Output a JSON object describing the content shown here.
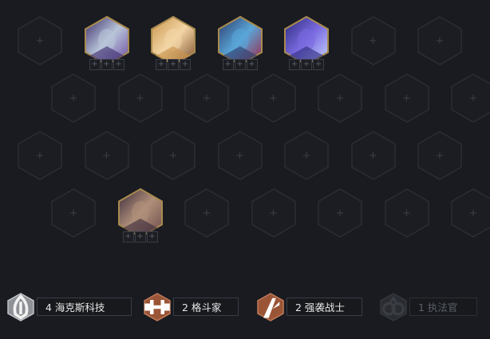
{
  "board": {
    "empty_slot_glyph": "+",
    "item_slot_glyph": "+",
    "rows": [
      {
        "slots": [
          {
            "unit": null
          },
          {
            "unit": {
              "name": "champion-mech",
              "cost_color": "#a88a4e",
              "items": [
                "+",
                "+",
                "+"
              ]
            }
          },
          {
            "unit": {
              "name": "champion-golden",
              "cost_color": "#a88a4e",
              "items": [
                "+",
                "+",
                "+"
              ]
            }
          },
          {
            "unit": {
              "name": "champion-crystal-red",
              "cost_color": "#a88a4e",
              "items": [
                "+",
                "+",
                "+"
              ]
            }
          },
          {
            "unit": {
              "name": "champion-crystal-purple",
              "cost_color": "#a88a4e",
              "items": [
                "+",
                "+",
                "+"
              ]
            }
          },
          {
            "unit": null
          },
          {
            "unit": null
          }
        ]
      },
      {
        "slots": [
          {
            "unit": null
          },
          {
            "unit": null
          },
          {
            "unit": null
          },
          {
            "unit": null
          },
          {
            "unit": null
          },
          {
            "unit": null
          },
          {
            "unit": null
          }
        ]
      },
      {
        "slots": [
          {
            "unit": null
          },
          {
            "unit": null
          },
          {
            "unit": null
          },
          {
            "unit": null
          },
          {
            "unit": null
          },
          {
            "unit": null
          },
          {
            "unit": null
          }
        ]
      },
      {
        "slots": [
          {
            "unit": null
          },
          {
            "unit": {
              "name": "champion-brawler",
              "cost_color": "#a88a4e",
              "items": [
                "+",
                "+",
                "+"
              ]
            }
          },
          {
            "unit": null
          },
          {
            "unit": null
          },
          {
            "unit": null
          },
          {
            "unit": null
          },
          {
            "unit": null
          }
        ]
      }
    ]
  },
  "traits": [
    {
      "label": "4 海克斯科技",
      "icon": "hextech-icon",
      "tier_color": "#8e9196",
      "active": true
    },
    {
      "label": "2 格斗家",
      "icon": "brawler-icon",
      "tier_color": "#9a5436",
      "active": true
    },
    {
      "label": "2 强袭战士",
      "icon": "challenger-icon",
      "tier_color": "#9a5436",
      "active": true
    },
    {
      "label": "1 执法官",
      "icon": "enforcer-icon",
      "tier_color": "#2a2c31",
      "active": false
    }
  ]
}
